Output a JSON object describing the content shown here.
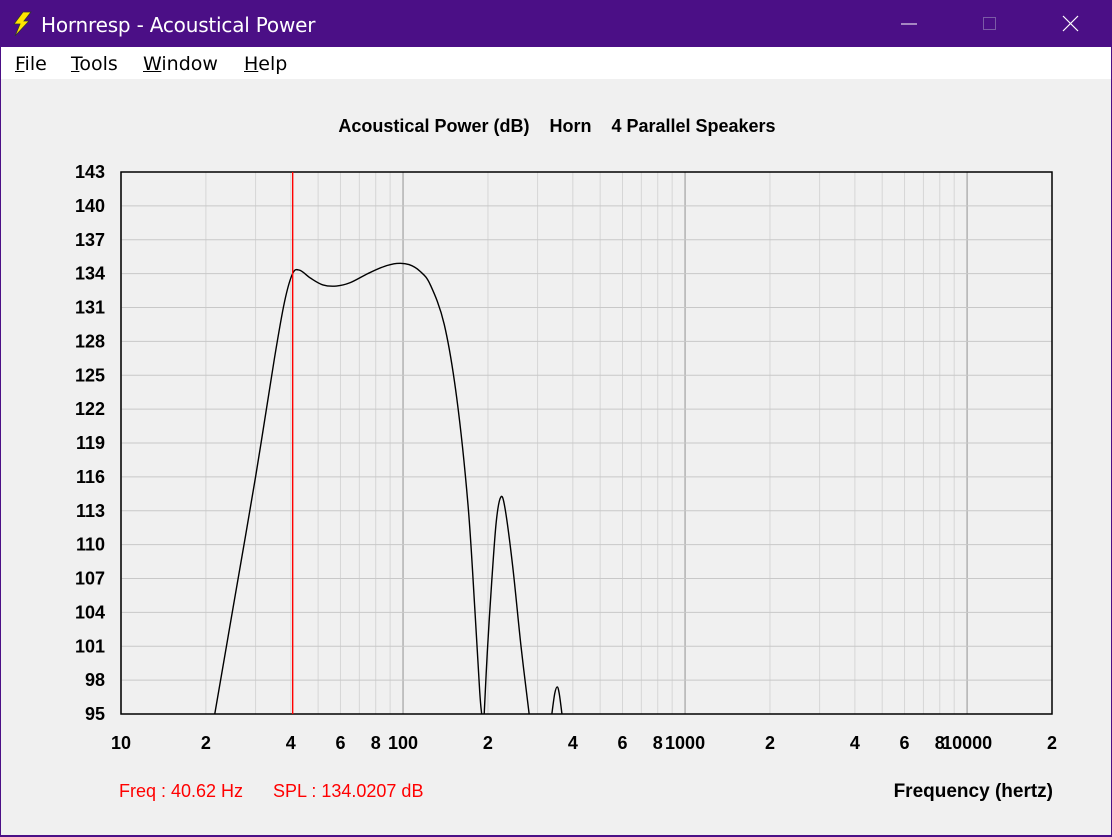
{
  "window": {
    "title": "Hornresp - Acoustical Power",
    "controls": {
      "minimize": "minimize",
      "maximize": "maximize",
      "close": "close"
    }
  },
  "menu": {
    "items": [
      {
        "label": "File",
        "accel": "F",
        "rest": "ile"
      },
      {
        "label": "Tools",
        "accel": "T",
        "rest": "ools"
      },
      {
        "label": "Window",
        "accel": "W",
        "rest": "indow"
      },
      {
        "label": "Help",
        "accel": "H",
        "rest": "elp"
      }
    ]
  },
  "chart_data": {
    "type": "line",
    "title": "Acoustical Power (dB)    Horn    4 Parallel Speakers",
    "xlabel": "Frequency (hertz)",
    "ylabel": "",
    "xscale": "log",
    "xlim": [
      10,
      20000
    ],
    "ylim": [
      95,
      143
    ],
    "grid": true,
    "y_ticks": [
      143,
      140,
      137,
      134,
      131,
      128,
      125,
      122,
      119,
      116,
      113,
      110,
      107,
      104,
      101,
      98,
      95
    ],
    "x_tick_labels": [
      {
        "x": 10,
        "label": "10"
      },
      {
        "x": 20,
        "label": "2"
      },
      {
        "x": 40,
        "label": "4"
      },
      {
        "x": 60,
        "label": "6"
      },
      {
        "x": 80,
        "label": "8"
      },
      {
        "x": 100,
        "label": "100"
      },
      {
        "x": 200,
        "label": "2"
      },
      {
        "x": 400,
        "label": "4"
      },
      {
        "x": 600,
        "label": "6"
      },
      {
        "x": 800,
        "label": "8"
      },
      {
        "x": 1000,
        "label": "1000"
      },
      {
        "x": 2000,
        "label": "2"
      },
      {
        "x": 4000,
        "label": "4"
      },
      {
        "x": 6000,
        "label": "6"
      },
      {
        "x": 8000,
        "label": "8"
      },
      {
        "x": 10000,
        "label": "10000"
      },
      {
        "x": 20000,
        "label": "2"
      }
    ],
    "cursor": {
      "freq": 40.62,
      "color": "#ff0000"
    },
    "series": [
      {
        "color": "#000000",
        "points": [
          [
            21.5,
            95
          ],
          [
            25,
            104.5
          ],
          [
            30,
            116
          ],
          [
            35,
            126.5
          ],
          [
            38,
            131.5
          ],
          [
            40.6,
            134.0
          ],
          [
            43,
            134.3
          ],
          [
            47,
            133.6
          ],
          [
            52,
            133.0
          ],
          [
            58,
            132.9
          ],
          [
            65,
            133.2
          ],
          [
            75,
            134.0
          ],
          [
            85,
            134.6
          ],
          [
            95,
            134.9
          ],
          [
            105,
            134.8
          ],
          [
            115,
            134.2
          ],
          [
            125,
            133.0
          ],
          [
            140,
            129.5
          ],
          [
            155,
            123.0
          ],
          [
            170,
            113.5
          ],
          [
            180,
            104
          ],
          [
            187,
            97
          ],
          [
            190,
            95
          ]
        ]
      },
      {
        "color": "#000000",
        "points": [
          [
            194,
            95
          ],
          [
            199,
            100.5
          ],
          [
            206,
            106.5
          ],
          [
            214,
            112
          ],
          [
            222,
            114.2
          ],
          [
            230,
            113.2
          ],
          [
            245,
            108
          ],
          [
            262,
            101
          ],
          [
            280,
            95
          ]
        ]
      },
      {
        "color": "#000000",
        "points": [
          [
            337,
            95
          ],
          [
            345,
            96.8
          ],
          [
            352,
            97.4
          ],
          [
            358,
            96.8
          ],
          [
            366,
            95
          ]
        ]
      }
    ]
  },
  "status": {
    "freq_text": "Freq : 40.62 Hz",
    "spl_text": "SPL : 134.0207 dB"
  },
  "colors": {
    "titlebar": "#4b0f86",
    "cursor": "#ff0000",
    "grid": "#c8c8c8",
    "status_text": "#ff0000"
  }
}
